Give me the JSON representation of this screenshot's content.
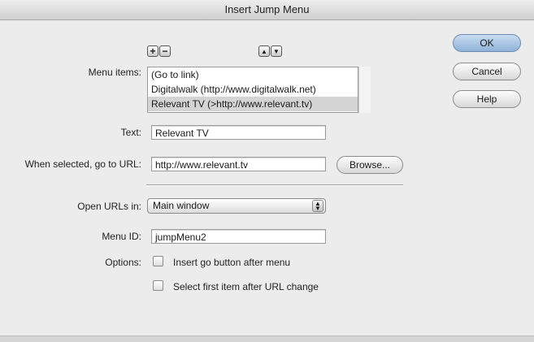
{
  "window": {
    "title": "Insert Jump Menu"
  },
  "toolbar": {
    "add_symbol": "+",
    "remove_symbol": "−",
    "up_symbol": "▲",
    "down_symbol": "▼"
  },
  "menu_items": {
    "label": "Menu items:",
    "items": [
      {
        "text": "(Go to link)",
        "selected": false
      },
      {
        "text": "Digitalwalk (http://www.digitalwalk.net)",
        "selected": false
      },
      {
        "text": "Relevant TV (>http://www.relevant.tv)",
        "selected": true
      }
    ]
  },
  "text_field": {
    "label": "Text:",
    "value": "Relevant TV"
  },
  "url_field": {
    "label": "When selected, go to URL:",
    "value": "http://www.relevant.tv"
  },
  "browse_button": {
    "label": "Browse..."
  },
  "open_urls": {
    "label": "Open URLs in:",
    "value": "Main window"
  },
  "menu_id": {
    "label": "Menu ID:",
    "value": "jumpMenu2"
  },
  "options": {
    "label": "Options:",
    "insert_go_button": {
      "label": "Insert go button after menu",
      "checked": false
    },
    "select_first_item": {
      "label": "Select first item after URL change",
      "checked": false
    }
  },
  "buttons": {
    "ok": "OK",
    "cancel": "Cancel",
    "help": "Help"
  },
  "colors": {
    "default_button": "#a9c7e6",
    "list_selection": "#d4d4d4"
  }
}
